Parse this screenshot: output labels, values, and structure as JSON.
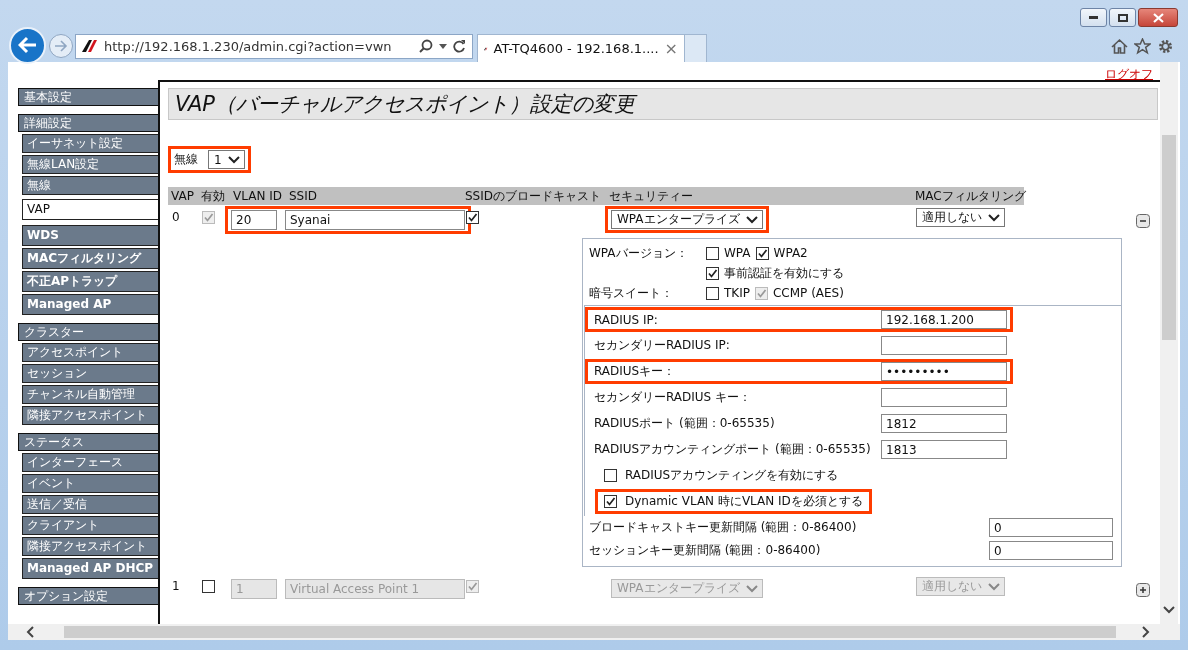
{
  "browser": {
    "address": "http://192.168.1.230/admin.cgi?action=vwn",
    "tab_title": "AT-TQ4600 - 192.168.1....",
    "tab_close": "×"
  },
  "logoff": "ログオフ",
  "sidebar": [
    {
      "title": "基本設定"
    },
    {
      "title": "詳細設定",
      "items": [
        {
          "label": "イーサネット設定",
          "kind": "item",
          "selected": false
        },
        {
          "label": "無線LAN設定",
          "kind": "item",
          "selected": false
        },
        {
          "label": "無線",
          "kind": "item",
          "selected": false
        },
        {
          "label": "VAP",
          "kind": "item",
          "selected": true
        },
        {
          "label": "WDS",
          "kind": "item-bold",
          "selected": false
        },
        {
          "label": "MACフィルタリング",
          "kind": "item-bold",
          "selected": false
        },
        {
          "label": "不正APトラップ",
          "kind": "item-bold",
          "selected": false
        },
        {
          "label": "Managed AP",
          "kind": "item-bold",
          "selected": false
        }
      ]
    },
    {
      "title": "クラスター",
      "items": [
        {
          "label": "アクセスポイント",
          "kind": "item",
          "selected": false
        },
        {
          "label": "セッション",
          "kind": "item",
          "selected": false
        },
        {
          "label": "チャンネル自動管理",
          "kind": "item",
          "selected": false
        },
        {
          "label": "隣接アクセスポイント",
          "kind": "item",
          "selected": false
        }
      ]
    },
    {
      "title": "ステータス",
      "items": [
        {
          "label": "インターフェース",
          "kind": "item",
          "selected": false
        },
        {
          "label": "イベント",
          "kind": "item",
          "selected": false
        },
        {
          "label": "送信／受信",
          "kind": "item",
          "selected": false
        },
        {
          "label": "クライアント",
          "kind": "item",
          "selected": false
        },
        {
          "label": "隣接アクセスポイント",
          "kind": "item",
          "selected": false
        },
        {
          "label": "Managed AP DHCP",
          "kind": "item-bold",
          "selected": false
        }
      ]
    },
    {
      "title": "オプション設定"
    }
  ],
  "page": {
    "title": "VAP（バーチャルアクセスポイント）設定の変更"
  },
  "radio": {
    "label": "無線",
    "value": "1",
    "highlighted": true
  },
  "table": {
    "columns": [
      "VAP",
      "有効",
      "VLAN ID",
      "SSID",
      "SSIDのブロードキャスト",
      "セキュリティー",
      "MACフィルタリング"
    ],
    "rows": [
      {
        "vap": "0",
        "enabled": {
          "checked": true,
          "disabled": true
        },
        "vlan_id": "20",
        "ssid": "Syanai",
        "broadcast": {
          "checked": true,
          "disabled": false
        },
        "security": "WPAエンタープライズ",
        "mac_filter": "適用しない",
        "fields_disabled": false,
        "id_highlighted": true,
        "security_highlighted": true,
        "expanded": true,
        "details": {
          "version_label": "WPAバージョン：",
          "versions": [
            {
              "label": "WPA",
              "checked": false,
              "disabled": false
            },
            {
              "label": "WPA2",
              "checked": true,
              "disabled": false
            }
          ],
          "preauth": {
            "label": "事前認証を有効にする",
            "checked": true,
            "disabled": false
          },
          "cipher_label": "暗号スイート：",
          "ciphers": [
            {
              "label": "TKIP",
              "checked": false,
              "disabled": false
            },
            {
              "label": "CCMP (AES)",
              "checked": true,
              "disabled": true
            }
          ],
          "radius": [
            {
              "kind": "field",
              "label": "RADIUS IP:",
              "value": "192.168.1.200",
              "highlighted": true
            },
            {
              "kind": "field",
              "label": "セカンダリーRADIUS IP:",
              "highlighted": false
            },
            {
              "kind": "field",
              "label": "RADIUSキー：",
              "value": "•••••••••",
              "highlighted": true
            },
            {
              "kind": "field",
              "label": "セカンダリーRADIUS キー：",
              "highlighted": false
            },
            {
              "kind": "field",
              "label": "RADIUSポート (範囲：0-65535)",
              "value": "1812",
              "highlighted": false
            },
            {
              "kind": "field",
              "label": "RADIUSアカウンティングポート (範囲：0-65535)",
              "value": "1813",
              "highlighted": false
            },
            {
              "kind": "checkbox",
              "label": "RADIUSアカウンティングを有効にする",
              "checked": false,
              "disabled": false,
              "highlighted": false
            },
            {
              "kind": "checkbox",
              "label": "Dynamic VLAN 時にVLAN IDを必須とする",
              "checked": true,
              "disabled": false,
              "highlighted": true
            }
          ],
          "intervals": [
            {
              "label": "ブロードキャストキー更新間隔 (範囲：0-86400)",
              "value": "0"
            },
            {
              "label": "セッションキー更新間隔 (範囲：0-86400)",
              "value": "0"
            }
          ]
        }
      },
      {
        "vap": "1",
        "enabled": {
          "checked": false,
          "disabled": false
        },
        "vlan_id": "1",
        "ssid": "Virtual Access Point 1",
        "broadcast": {
          "checked": true,
          "disabled": true
        },
        "security": "WPAエンタープライズ",
        "mac_filter": "適用しない",
        "fields_disabled": true,
        "id_highlighted": false,
        "security_highlighted": false,
        "expanded": false
      }
    ]
  }
}
